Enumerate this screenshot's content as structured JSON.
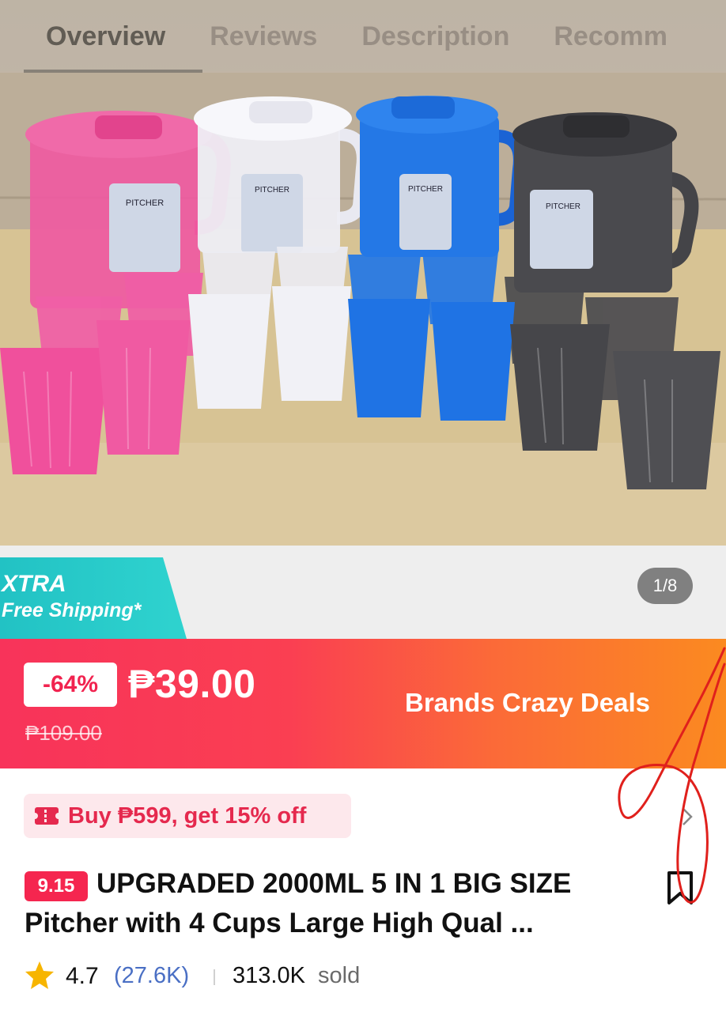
{
  "tabs": [
    "Overview",
    "Reviews",
    "Description",
    "Recomm"
  ],
  "active_tab": "Overview",
  "gallery": {
    "counter": "1/8"
  },
  "shipping_badge": {
    "title": "XTRA",
    "subtitle": "Free Shipping*",
    "color": "#22c2c4"
  },
  "price": {
    "discount": "-64%",
    "current": "₱39.00",
    "original": "₱109.00",
    "campaign": "Brands Crazy Deals",
    "gradient_start": "#f8335a",
    "gradient_end": "#fb8a20"
  },
  "voucher": {
    "text": "Buy ₱599, get 15% off",
    "icon": "voucher-icon",
    "color": "#e5294e"
  },
  "product": {
    "badge": "9.15",
    "title_line1": "UPGRADED 2000ML 5 IN 1 BIG SIZE",
    "title_line2": "Pitcher with 4 Cups Large High Qual ..."
  },
  "rating": {
    "score": "4.7",
    "reviews": "(27.6K)",
    "sold_count": "313.0K",
    "sold_label": "sold"
  },
  "photo": {
    "pitcher_colors": [
      "#ef4f9a",
      "#e6e7ee",
      "#1f6fe0",
      "#3d3d40"
    ],
    "pitcher_label": "PITCHER",
    "pitcher_capacity": "2.0"
  }
}
